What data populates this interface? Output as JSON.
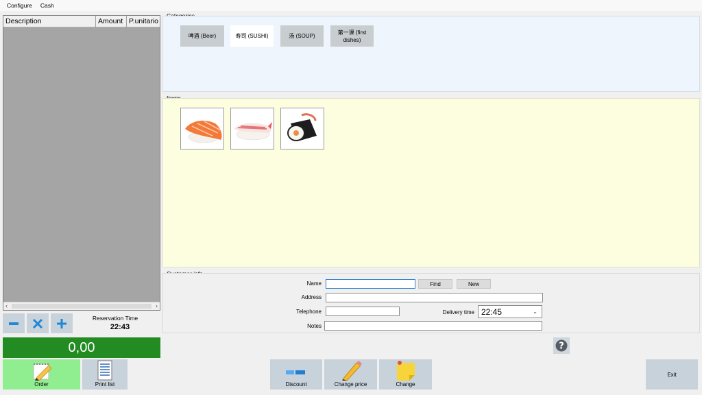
{
  "menu": {
    "configure": "Configure",
    "cash": "Cash"
  },
  "order": {
    "columns": {
      "description": "Description",
      "amount": "Amount",
      "unit_price": "P.unitario"
    },
    "reservation_label": "Reservation Time",
    "reservation_time": "22:43",
    "total": "0,00"
  },
  "categories": {
    "title": "Categories",
    "items": [
      "啤酒 (Beer)",
      "寿司 (SUSHI)",
      "汤 (SOUP)",
      "第一课 (first dishes)"
    ],
    "active_index": 1
  },
  "items": {
    "title": "Items",
    "tiles": [
      "salmon-nigiri-icon",
      "shrimp-nigiri-icon",
      "maki-roll-icon"
    ]
  },
  "customer": {
    "title": "Customer info",
    "name_label": "Name",
    "name_value": "",
    "find": "Find",
    "new": "New",
    "address_label": "Address",
    "address_value": "",
    "telephone_label": "Telephone",
    "telephone_value": "",
    "delivery_label": "Delivery time",
    "delivery_value": "22:45",
    "notes_label": "Notes",
    "notes_value": ""
  },
  "toolbar": {
    "order": "Order",
    "print_list": "Print list",
    "discount": "Discount",
    "change_price": "Change price",
    "change": "Change",
    "exit": "Exit"
  },
  "colors": {
    "total_bg": "#228b22",
    "order_btn_bg": "#90ee90",
    "tool_bg": "#c8d2da",
    "categories_bg": "#eef5fd",
    "items_bg": "#fdfde0"
  }
}
